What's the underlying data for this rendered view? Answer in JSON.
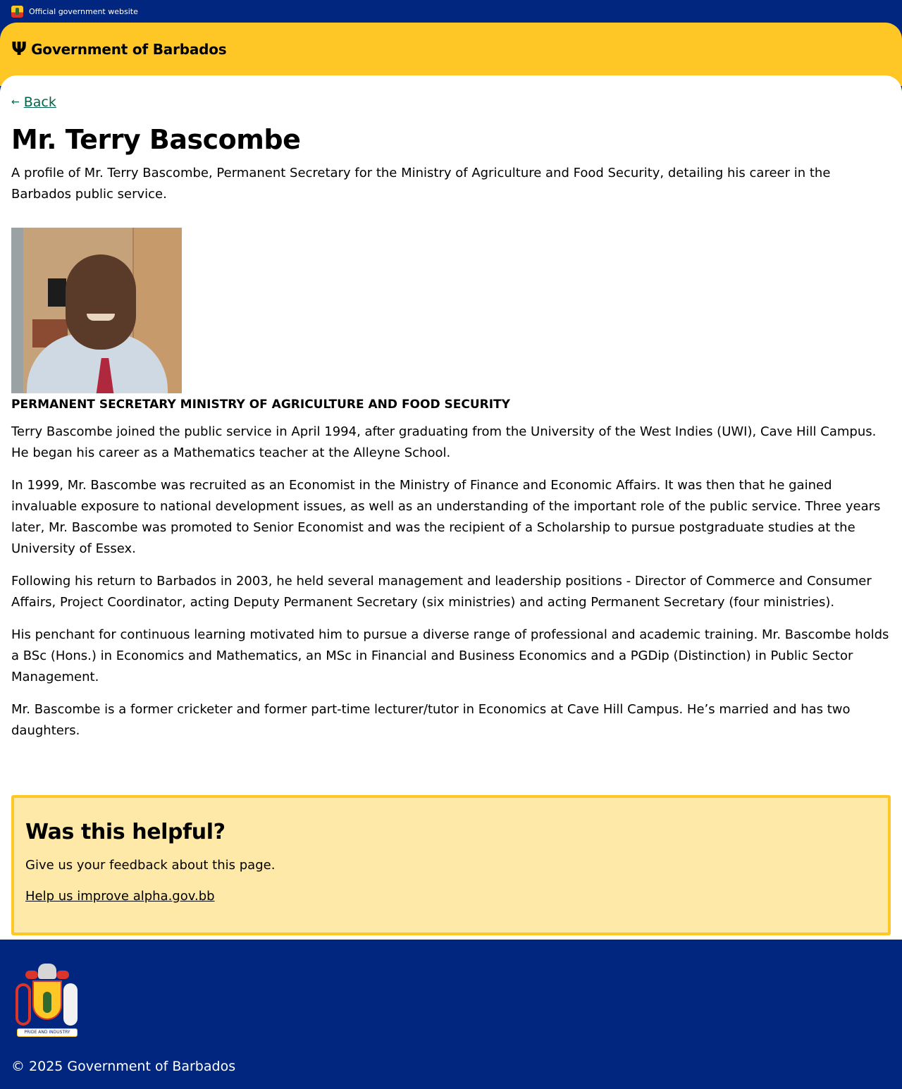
{
  "topbar": {
    "label": "Official government website"
  },
  "header": {
    "brand": "Government of Barbados",
    "logo_icon": "trident-icon"
  },
  "nav": {
    "back_label": "Back"
  },
  "page": {
    "title": "Mr. Terry Bascombe",
    "summary": "A profile of Mr. Terry Bascombe, Permanent Secretary for the Ministry of Agriculture and Food Security, detailing his career in the Barbados public service.",
    "role": "PERMANENT SECRETARY MINISTRY OF AGRICULTURE AND FOOD SECURITY",
    "paragraphs": [
      "Terry Bascombe joined the public service in April 1994, after graduating from the University of the West Indies (UWI), Cave Hill Campus. He began his career as a Mathematics teacher at the Alleyne School.",
      "In 1999, Mr. Bascombe was recruited as an Economist in the Ministry of Finance and Economic Affairs. It was then that he gained invaluable exposure to national development issues, as well as an understanding of the important role of the public service. Three years later, Mr. Bascombe was promoted to Senior Economist and was the recipient of a Scholarship to pursue postgraduate studies at the University of Essex.",
      "Following his return to Barbados in 2003, he held several management and leadership positions - Director of Commerce and Consumer Affairs, Project Coordinator, acting Deputy Permanent Secretary (six ministries) and acting Permanent Secretary (four ministries).",
      "His penchant for continuous learning motivated him to pursue a diverse range of professional and academic training. Mr. Bascombe holds a BSc (Hons.) in Economics and Mathematics, an MSc in Financial and Business Economics and a PGDip (Distinction) in Public Sector Management.",
      "Mr. Bascombe is a former cricketer and former part-time lecturer/tutor in Economics at Cave Hill Campus. He’s married and has two daughters."
    ]
  },
  "feedback": {
    "title": "Was this helpful?",
    "text": "Give us your feedback about this page.",
    "link": "Help us improve alpha.gov.bb"
  },
  "footer": {
    "copyright": "© 2025 Government of Barbados",
    "scroll_text": "PRIDE AND INDUSTRY"
  },
  "colors": {
    "navy": "#00267f",
    "gold": "#ffc726",
    "link_green": "#00654b",
    "feedback_bg": "#ffe9a9"
  }
}
